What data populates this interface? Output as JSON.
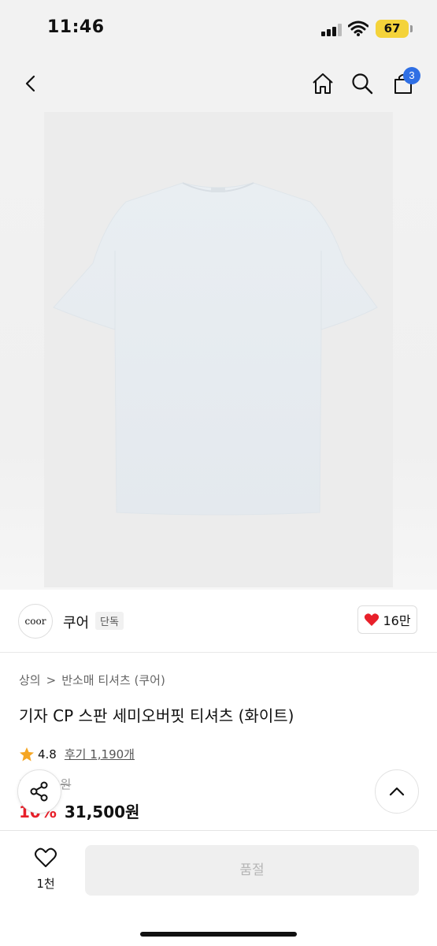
{
  "status": {
    "time": "11:46",
    "battery": "67"
  },
  "header": {
    "cart_count": "3"
  },
  "brand": {
    "logo_text": "coor",
    "name": "쿠어",
    "tag": "단독",
    "likes": "16만"
  },
  "breadcrumb": {
    "level1": "상의",
    "separator": ">",
    "level2": "반소매 티셔츠 (쿠어)"
  },
  "product": {
    "title": "기자 CP 스판 세미오버핏 티셔츠 (화이트)",
    "rating": "4.8",
    "review_label": "후기 1,190개",
    "original_price": "35,000원",
    "discount": "10%",
    "price": "31,500원"
  },
  "bottom": {
    "wish_count": "1천",
    "soldout_label": "품절"
  },
  "colors": {
    "accent_blue": "#2f6fe4",
    "heart_red": "#e8202a",
    "star": "#f5a623"
  }
}
